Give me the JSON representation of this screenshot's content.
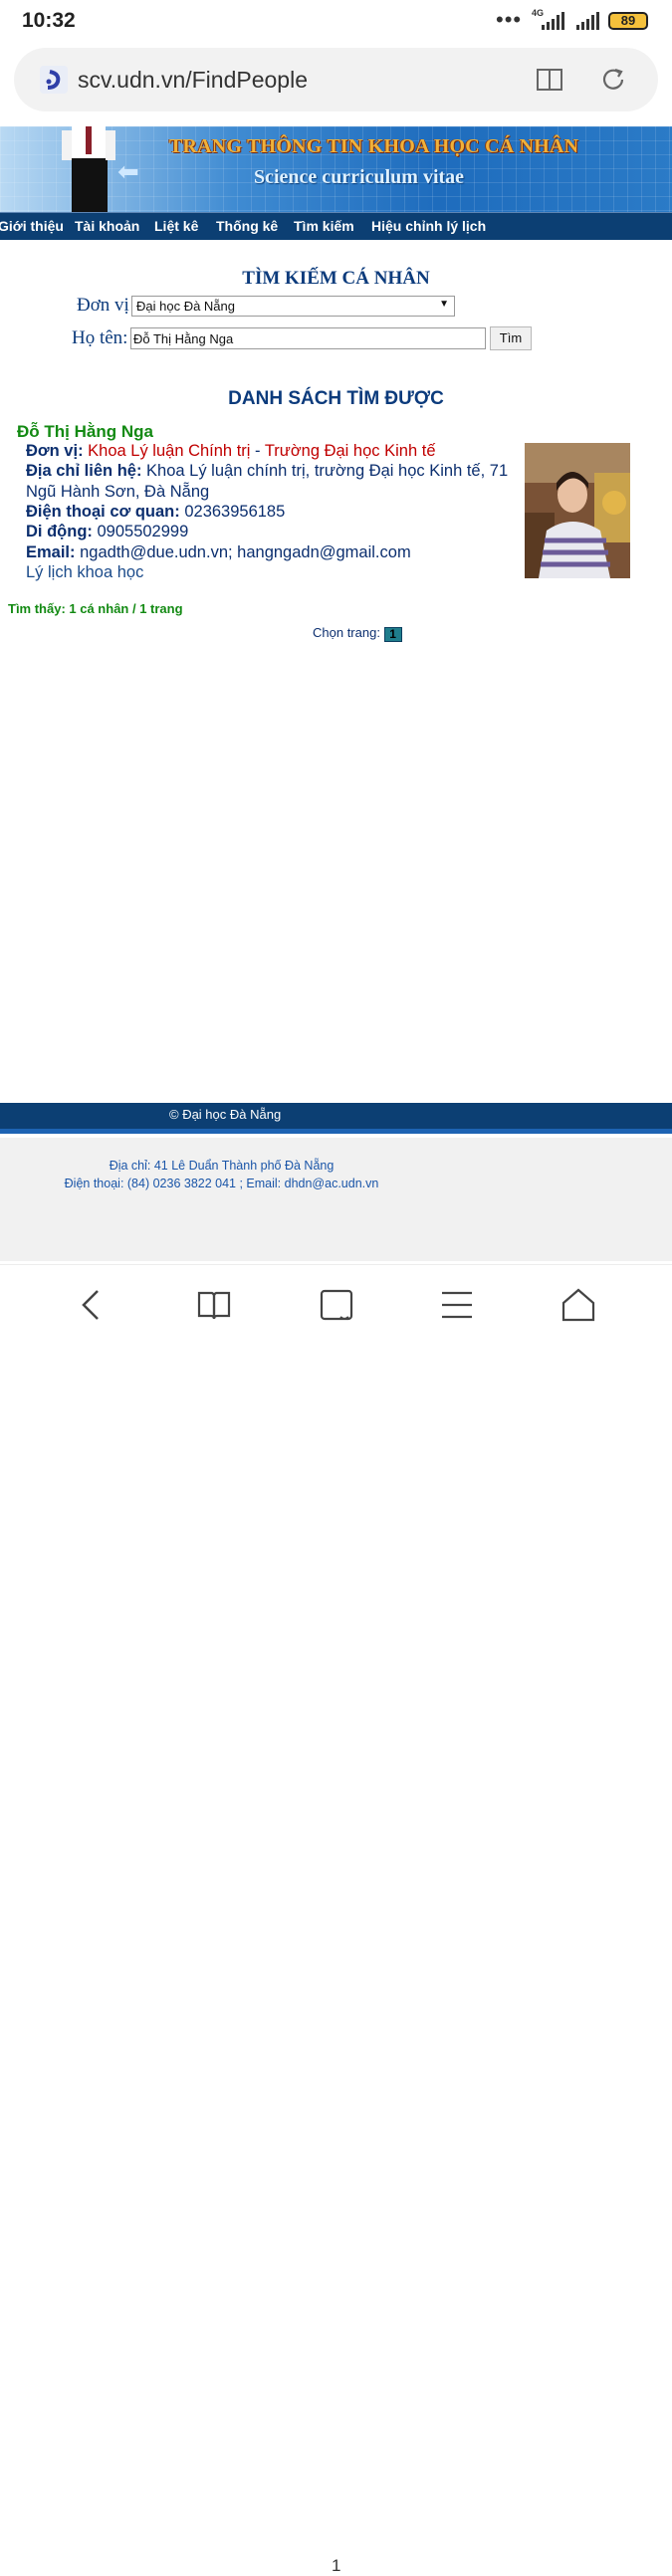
{
  "status_bar": {
    "time": "10:32",
    "network": "4G",
    "battery": "89",
    "battery_color": "#f5c13b"
  },
  "url_bar": {
    "url": "scv.udn.vn/FindPeople"
  },
  "banner": {
    "title": "TRANG THÔNG TIN KHOA HỌC CÁ NHÂN",
    "subtitle": "Science curriculum vitae"
  },
  "nav": {
    "items": [
      "Giới thiệu",
      "Tài khoản",
      "Liệt kê",
      "Thống kê",
      "Tìm kiếm",
      "Hiệu chỉnh lý lịch"
    ]
  },
  "search": {
    "title": "TÌM KIẾM CÁ NHÂN",
    "unit_label": "Đơn vị",
    "unit_value": "Đại học Đà Nẵng",
    "name_label": "Họ tên:",
    "name_value": "Đỗ Thị Hằng Nga",
    "button": "Tìm"
  },
  "results": {
    "title": "DANH SÁCH TÌM ĐƯỢC",
    "person": {
      "name": "Đỗ Thị Hằng Nga",
      "unit_label": "Đơn vị:",
      "unit_dept": "Khoa Lý luận Chính trị",
      "unit_sep": " - ",
      "unit_school": "Trường Đại học Kinh tế",
      "address_label": "Địa chỉ liên hệ:",
      "address_line1": "Khoa Lý luận chính trị, trường Đại học Kinh tế, 71",
      "address_line2": "Ngũ Hành Sơn, Đà Nẵng",
      "office_phone_label": "Điện thoại cơ quan:",
      "office_phone": "02363956185",
      "mobile_label": "Di động:",
      "mobile": "0905502999",
      "email_label": "Email:",
      "email": "ngadth@due.udn.vn; hangngadn@gmail.com",
      "cv_link": "Lý lịch khoa học"
    },
    "found_text": "Tìm thấy: 1 cá nhân / 1 trang",
    "pager_label": "Chọn trang:",
    "current_page": "1"
  },
  "footer": {
    "copyright": "© Đại học Đà Nẵng",
    "address": "Địa chỉ: 41 Lê Duẩn Thành phố Đà Nẵng",
    "contact": "Điện thoại: (84) 0236 3822 041 ; Email: dhdn@ac.udn.vn"
  },
  "bottom_nav": {
    "tab_count": "1",
    "icons": [
      "back-icon",
      "bookmarks-icon",
      "tabs-icon",
      "menu-icon",
      "home-icon"
    ]
  },
  "colors": {
    "nav_bg": "#0c3f73",
    "heading": "#0c3b7c",
    "name_green": "#138a13",
    "red": "#c00000"
  }
}
